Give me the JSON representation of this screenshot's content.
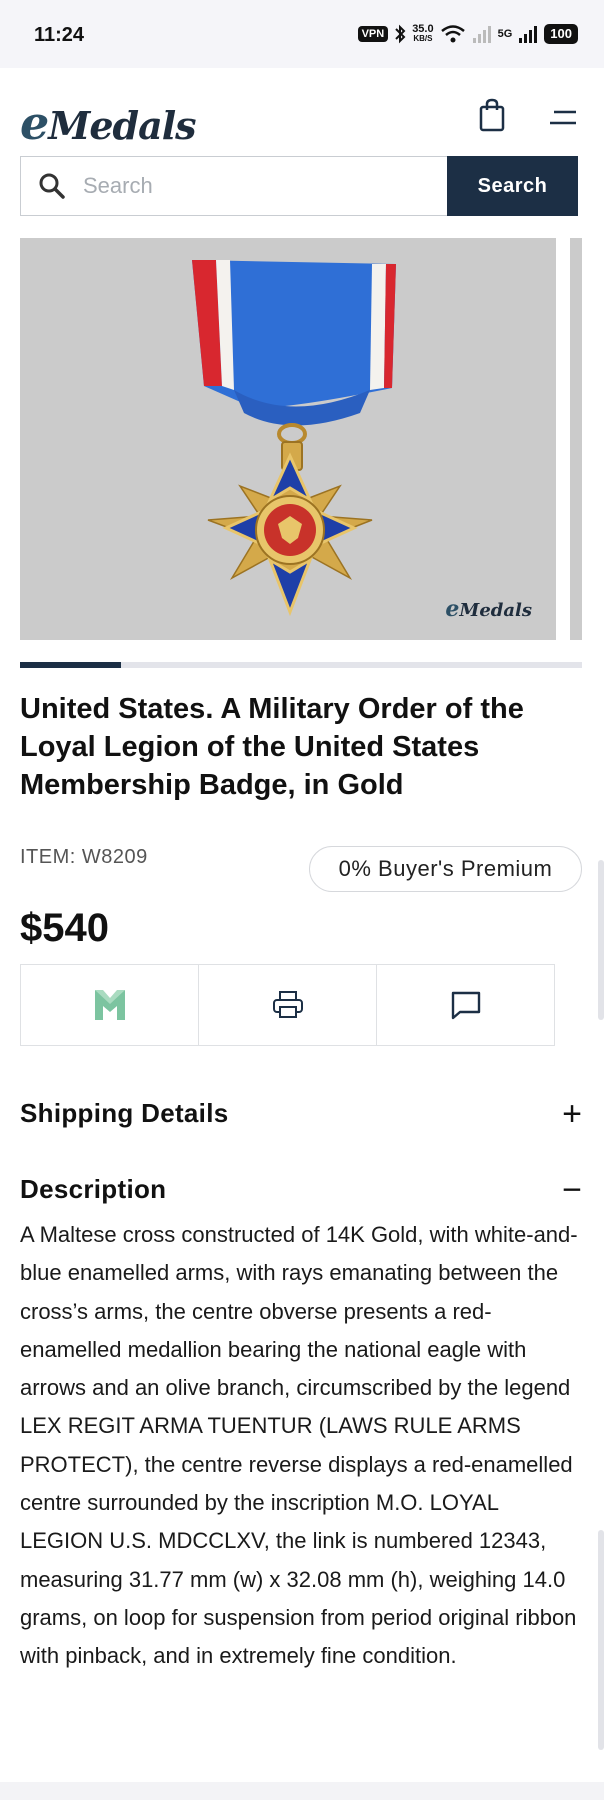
{
  "status": {
    "time": "11:24",
    "vpn": "VPN",
    "speed_value": "35.0",
    "speed_unit": "KB/S",
    "network": "5G",
    "battery": "100"
  },
  "header": {
    "logo_e": "e",
    "logo_rest": "Medals"
  },
  "search": {
    "placeholder": "Search",
    "button_label": "Search"
  },
  "gallery": {
    "watermark_e": "e",
    "watermark_rest": "Medals",
    "progress": 0.18
  },
  "product": {
    "title": "United States. A Military Order of the Loyal Legion of the United States Membership Badge, in Gold",
    "item_id": "ITEM: W8209",
    "premium": "0% Buyer's Premium",
    "price": "$540"
  },
  "actions": [
    {
      "icon": "m-logo-icon"
    },
    {
      "icon": "printer-icon"
    },
    {
      "icon": "chat-icon"
    }
  ],
  "sections": {
    "shipping_label": "Shipping Details",
    "shipping_toggle": "+",
    "description_label": "Description",
    "description_toggle": "−",
    "description_text": "A Maltese cross constructed of 14K Gold, with white-and-blue enamelled arms, with rays emanating between the cross’s arms, the centre obverse presents a red-enamelled medallion bearing the national eagle with arrows and an olive branch, circumscribed by the legend LEX REGIT ARMA TUENTUR (LAWS RULE ARMS PROTECT), the centre reverse displays a red-enamelled centre surrounded by the inscription M.O. LOYAL LEGION U.S. MDCCLXV, the link is numbered 12343, measuring 31.77 mm (w) x 32.08 mm (h), weighing 14.0 grams, on loop for suspension from period original ribbon with pinback, and in extremely fine condition."
  },
  "colors": {
    "brand_navy": "#1c2f45",
    "ribbon_blue": "#2f6fd6",
    "ribbon_red": "#d8272f",
    "medal_gold": "#d4a94a"
  }
}
